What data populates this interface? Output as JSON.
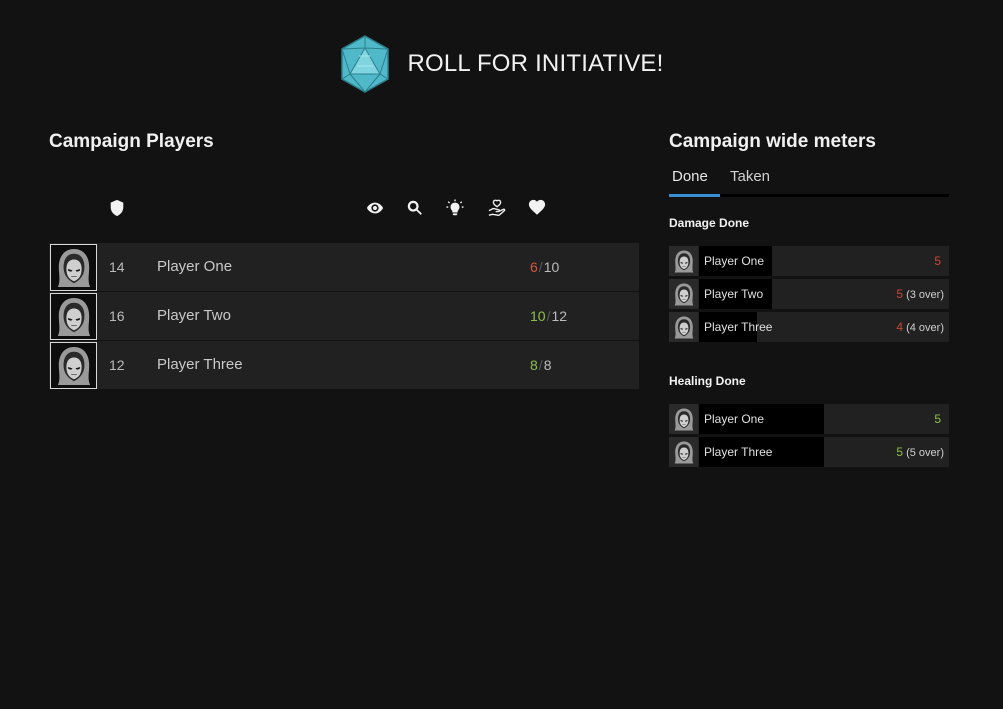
{
  "header": {
    "title": "ROLL FOR INITIATIVE!",
    "logo_icon": "d20-dice-icon",
    "logo_color": "#4fb8c9"
  },
  "players_section": {
    "title": "Campaign Players",
    "column_icons": [
      "shield-icon",
      "eye-icon",
      "search-icon",
      "lightbulb-icon",
      "hand-heart-icon",
      "heart-icon"
    ],
    "players": [
      {
        "initiative": "14",
        "name": "Player One",
        "hp_current": "6",
        "hp_max": "10",
        "hp_status": "low"
      },
      {
        "initiative": "16",
        "name": "Player Two",
        "hp_current": "10",
        "hp_max": "12",
        "hp_status": "ok"
      },
      {
        "initiative": "12",
        "name": "Player Three",
        "hp_current": "8",
        "hp_max": "8",
        "hp_status": "ok"
      }
    ]
  },
  "meters_section": {
    "title": "Campaign wide meters",
    "tabs": [
      {
        "label": "Done",
        "active": true
      },
      {
        "label": "Taken",
        "active": false
      }
    ],
    "damage": {
      "title": "Damage Done",
      "rows": [
        {
          "name": "Player One",
          "value": "5",
          "over": "",
          "fraction": 0.29
        },
        {
          "name": "Player Two",
          "value": "5",
          "over": "(3 over)",
          "fraction": 0.29
        },
        {
          "name": "Player Three",
          "value": "4",
          "over": "(4 over)",
          "fraction": 0.23
        }
      ]
    },
    "healing": {
      "title": "Healing Done",
      "rows": [
        {
          "name": "Player One",
          "value": "5",
          "over": "",
          "fraction": 0.5
        },
        {
          "name": "Player Three",
          "value": "5",
          "over": "(5 over)",
          "fraction": 0.5
        }
      ]
    }
  },
  "colors": {
    "accent": "#3a8fd4",
    "damage": "#c9473a",
    "healing": "#8cc049"
  }
}
